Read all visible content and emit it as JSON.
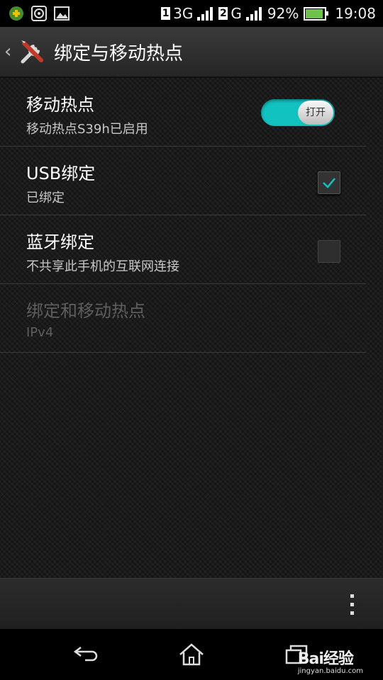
{
  "status_bar": {
    "sim1": "1",
    "net1": "3G",
    "sim2": "2",
    "net2": "G",
    "battery": "92%",
    "time": "19:08",
    "icons": [
      "app-notification-icon",
      "disc-icon",
      "image-icon",
      "signal-icon",
      "battery-icon"
    ]
  },
  "action_bar": {
    "title": "绑定与移动热点",
    "icon": "tools-icon"
  },
  "settings": [
    {
      "title": "移动热点",
      "summary": "移动热点S39h已启用",
      "control": "toggle",
      "state": "on",
      "toggle_label": "打开"
    },
    {
      "title": "USB绑定",
      "summary": "已绑定",
      "control": "checkbox",
      "checked": true
    },
    {
      "title": "蓝牙绑定",
      "summary": "不共享此手机的互联网连接",
      "control": "checkbox",
      "checked": false
    },
    {
      "title": "绑定和移动热点",
      "summary": "IPv4",
      "control": "none",
      "enabled": false
    }
  ],
  "colors": {
    "accent": "#11c2c0",
    "background": "#1a1a1a",
    "disabled_text": "#5e5e5e"
  },
  "navigation": {
    "buttons": [
      "back-icon",
      "home-icon",
      "recents-icon"
    ]
  },
  "watermark": {
    "brand": "Bai经验",
    "url": "jingyan.baidu.com"
  }
}
